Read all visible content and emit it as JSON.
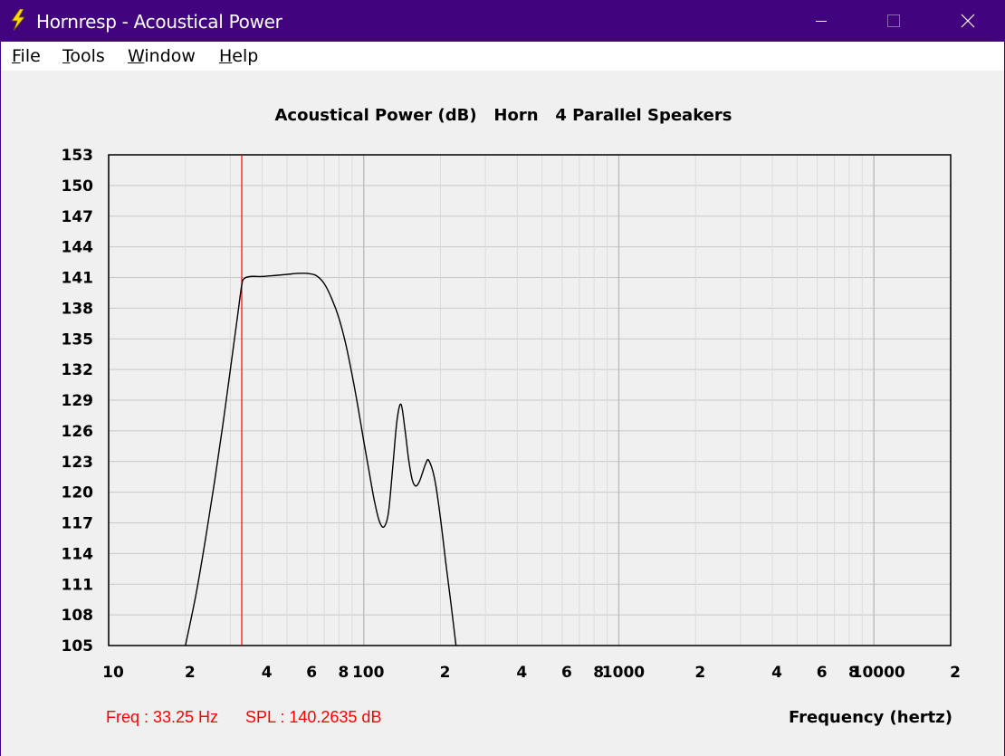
{
  "window": {
    "title": "Hornresp - Acoustical Power",
    "app_icon": "lightning-bolt-icon",
    "controls": [
      "minimize-icon",
      "maximize-icon",
      "close-icon"
    ],
    "colors": {
      "titlebar": "#42037f"
    }
  },
  "menu": {
    "items": [
      {
        "label": "File",
        "mnemonic": "F",
        "rest": "ile"
      },
      {
        "label": "Tools",
        "mnemonic": "T",
        "rest": "ools"
      },
      {
        "label": "Window",
        "mnemonic": "W",
        "rest": "indow"
      },
      {
        "label": "Help",
        "mnemonic": "H",
        "rest": "elp"
      }
    ]
  },
  "status": {
    "freq": "Freq : 33.25 Hz",
    "spl": "SPL : 140.2635 dB",
    "color": "#ff0000"
  },
  "chart_data": {
    "type": "line",
    "title": "Acoustical Power (dB)   Horn   4 Parallel Speakers",
    "xlabel": "Frequency (hertz)",
    "ylabel": "",
    "x_scale": "log",
    "xlim": [
      10,
      20000
    ],
    "ylim": [
      105,
      153
    ],
    "y_ticks": [
      "153",
      "150",
      "147",
      "144",
      "141",
      "138",
      "135",
      "132",
      "129",
      "126",
      "123",
      "120",
      "117",
      "114",
      "111",
      "108",
      "105"
    ],
    "x_tick_labels": [
      {
        "value": 10,
        "label": "10"
      },
      {
        "value": 20,
        "label": "2"
      },
      {
        "value": 40,
        "label": "4"
      },
      {
        "value": 60,
        "label": "6"
      },
      {
        "value": 80,
        "label": "8"
      },
      {
        "value": 100,
        "label": "100"
      },
      {
        "value": 200,
        "label": "2"
      },
      {
        "value": 400,
        "label": "4"
      },
      {
        "value": 600,
        "label": "6"
      },
      {
        "value": 800,
        "label": "8"
      },
      {
        "value": 1000,
        "label": "1000"
      },
      {
        "value": 2000,
        "label": "2"
      },
      {
        "value": 4000,
        "label": "4"
      },
      {
        "value": 6000,
        "label": "6"
      },
      {
        "value": 8000,
        "label": "8"
      },
      {
        "value": 10000,
        "label": "10000"
      },
      {
        "value": 20000,
        "label": "2"
      }
    ],
    "grid": true,
    "cursor_x": 33.25,
    "series": [
      {
        "color": "#000000",
        "x": [
          20,
          22,
          24,
          26,
          28,
          30,
          32,
          33.25,
          34,
          36,
          40,
          45,
          50,
          55,
          60,
          65,
          70,
          75,
          80,
          85,
          90,
          95,
          100,
          105,
          110,
          115,
          120,
          125,
          130,
          135,
          140,
          145,
          150,
          155,
          160,
          165,
          170,
          175,
          180,
          190,
          200,
          210,
          220,
          230
        ],
        "y": [
          105,
          110,
          115.5,
          121,
          126.5,
          132,
          137.2,
          140.2635,
          140.9,
          141.1,
          141.1,
          141.2,
          141.3,
          141.4,
          141.4,
          141.2,
          140.4,
          138.9,
          137,
          134.5,
          131.5,
          128.3,
          125,
          122,
          119.2,
          117.2,
          116.6,
          118,
          122.5,
          127,
          128.6,
          126.2,
          123.2,
          121.2,
          120.6,
          121,
          121.9,
          122.8,
          123.1,
          121.2,
          117.4,
          113,
          109,
          105
        ]
      }
    ]
  }
}
